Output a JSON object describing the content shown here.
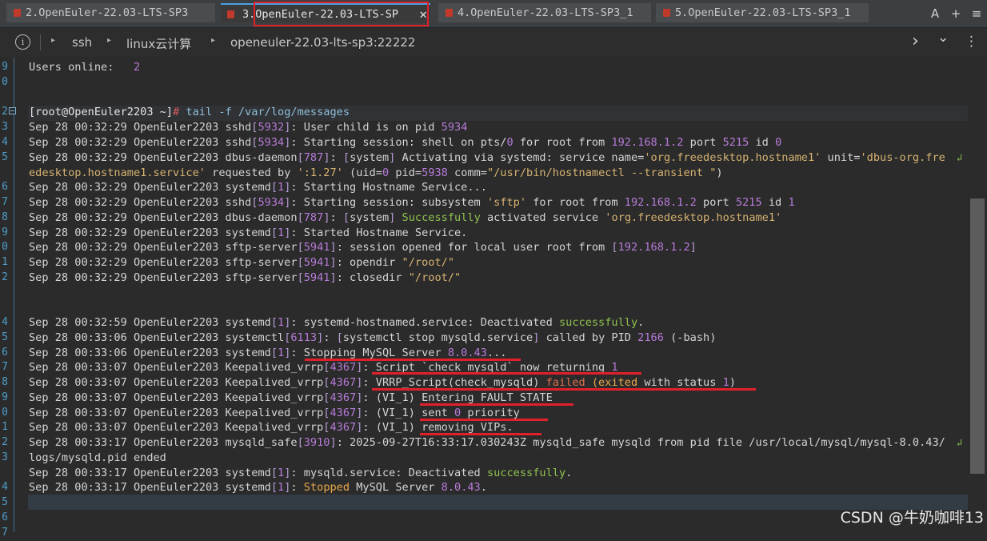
{
  "tabs": [
    {
      "label": "2.OpenEuler-22.03-LTS-SP3"
    },
    {
      "label": "3.OpenEuler-22.03-LTS-SP",
      "close": "✕"
    },
    {
      "label": "4.OpenEuler-22.03-LTS-SP3_1"
    },
    {
      "label": "5.OpenEuler-22.03-LTS-SP3_1"
    }
  ],
  "tabbar_actions": {
    "font": "A",
    "add": "+",
    "menu": "≡"
  },
  "breadcrumb": {
    "info": "i",
    "items": [
      "ssh",
      "linux云计算",
      "openeuler-22.03-lts-sp3:22222"
    ],
    "forward": "›",
    "dropdown": "⌄",
    "more": "⋮"
  },
  "gutter_numbers": [
    "9",
    "0",
    "",
    "",
    "2",
    "3",
    "4",
    "5",
    "",
    "6",
    "7",
    "8",
    "9",
    "0",
    "1",
    "2",
    "",
    "",
    "",
    "4",
    "5",
    "6",
    "7",
    "8",
    "9",
    "0",
    "1",
    "2",
    "3",
    "",
    "4",
    "5",
    "6",
    "7"
  ],
  "terminal": {
    "users_online_label": "Users online:",
    "users_online_value": "2",
    "prompt": "[root@OpenEuler2203 ~]",
    "hash": "#",
    "command": " tail -f /var/log/messages"
  },
  "watermark": "CSDN @牛奶咖啡13"
}
